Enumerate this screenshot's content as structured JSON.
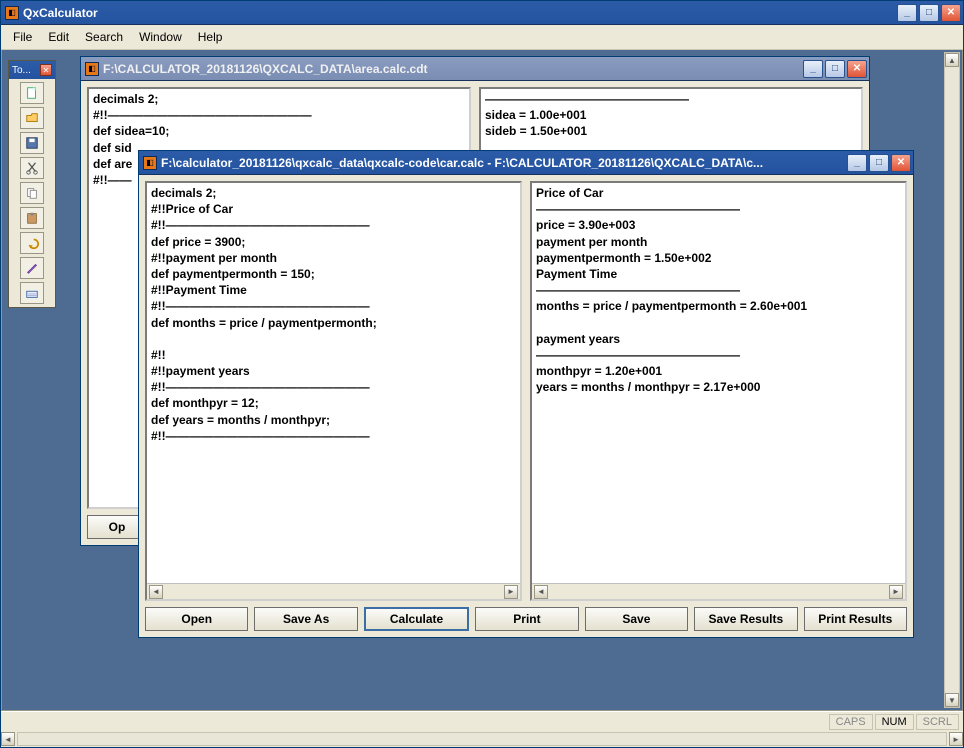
{
  "app": {
    "title": "QxCalculator"
  },
  "menu": {
    "file": "File",
    "edit": "Edit",
    "search": "Search",
    "window": "Window",
    "help": "Help"
  },
  "toolbox": {
    "title": "To..."
  },
  "status": {
    "caps": "CAPS",
    "num": "NUM",
    "scrl": "SCRL"
  },
  "backWindow": {
    "title": "F:\\CALCULATOR_20181126\\QXCALC_DATA\\area.calc.cdt",
    "left": "decimals 2;\n#!!—————————————————\ndef sidea=10;\ndef sid\ndef are\n#!!——",
    "right": "—————————————————\nsidea = 1.00e+001\nsideb = 1.50e+001",
    "buttons": {
      "open": "Op"
    }
  },
  "frontWindow": {
    "title": "F:\\calculator_20181126\\qxcalc_data\\qxcalc-code\\car.calc - F:\\CALCULATOR_20181126\\QXCALC_DATA\\c...",
    "left": "decimals 2;\n#!!Price of Car\n#!!—————————————————\ndef price = 3900;\n#!!payment per month\ndef paymentpermonth = 150;\n#!!Payment Time\n#!!—————————————————\ndef months = price / paymentpermonth;\n\n#!!\n#!!payment years\n#!!—————————————————\ndef monthpyr = 12;\ndef years = months / monthpyr;\n#!!—————————————————",
    "right": "Price of Car\n—————————————————\nprice = 3.90e+003\npayment per month\npaymentpermonth = 1.50e+002\nPayment Time\n—————————————————\nmonths = price / paymentpermonth = 2.60e+001\n\npayment years\n—————————————————\nmonthpyr = 1.20e+001\nyears = months / monthpyr = 2.17e+000",
    "buttons": {
      "open": "Open",
      "saveAs": "Save As",
      "calculate": "Calculate",
      "print": "Print",
      "save": "Save",
      "saveResults": "Save Results",
      "printResults": "Print Results"
    }
  }
}
